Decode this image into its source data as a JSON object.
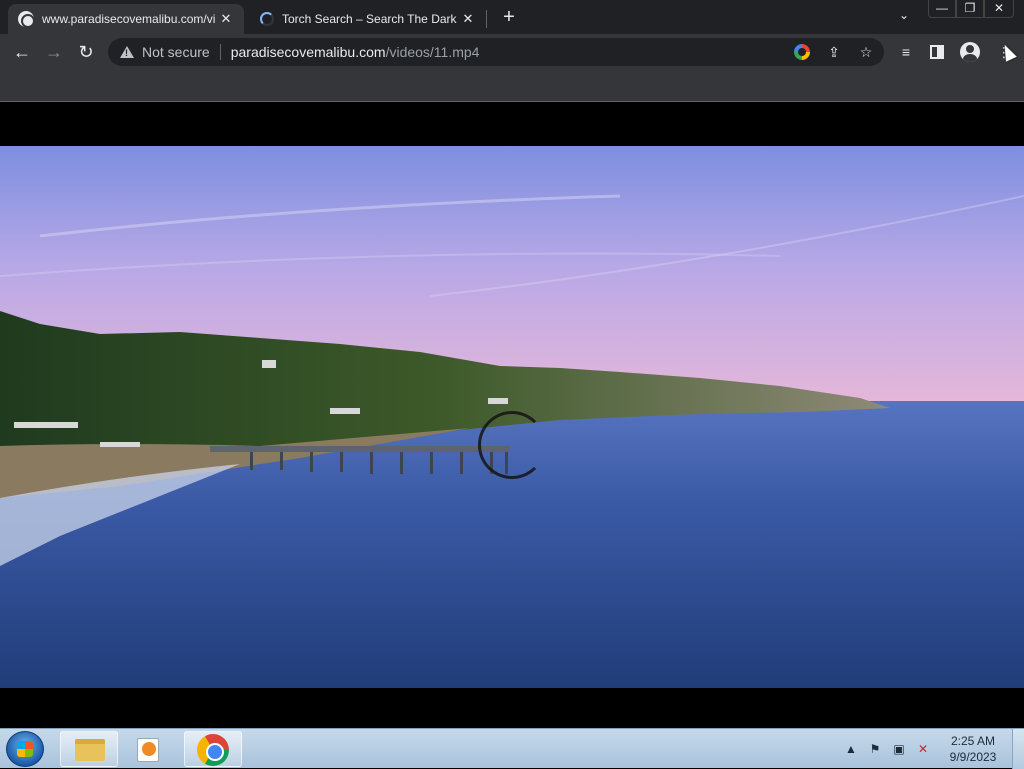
{
  "browser": {
    "tabs": [
      {
        "title": "www.paradisecovemalibu.com/vi",
        "icon": "globe-icon",
        "active": true
      },
      {
        "title": "Torch Search – Search The Dark N",
        "icon": "loading-spinner-icon",
        "active": false
      }
    ],
    "new_tab_label": "+",
    "tab_search_label": "⌄",
    "window_controls": {
      "minimize": "—",
      "maximize": "❐",
      "close": "✕"
    },
    "nav": {
      "back": "←",
      "forward": "→",
      "reload": "↻"
    },
    "omnibox": {
      "security_label": "Not secure",
      "url_host": "paradisecovemalibu.com",
      "url_path": "/videos/11.mp4"
    },
    "toolbar_glyphs": {
      "share": "⇪",
      "star": "☆",
      "reading_list": "≡",
      "menu": "⋮"
    }
  },
  "taskbar": {
    "clock_time": "2:25 AM",
    "clock_date": "9/9/2023",
    "tray_glyphs": {
      "show_hidden": "▲",
      "flag": "⚑",
      "network": "▣",
      "volume": "✕"
    }
  },
  "colors": {
    "sky_top": "#7d8fe0",
    "sky_horizon": "#e9b9d8",
    "ocean": "#2d4f95",
    "tabstrip": "#202124",
    "toolbar": "#35363a"
  }
}
